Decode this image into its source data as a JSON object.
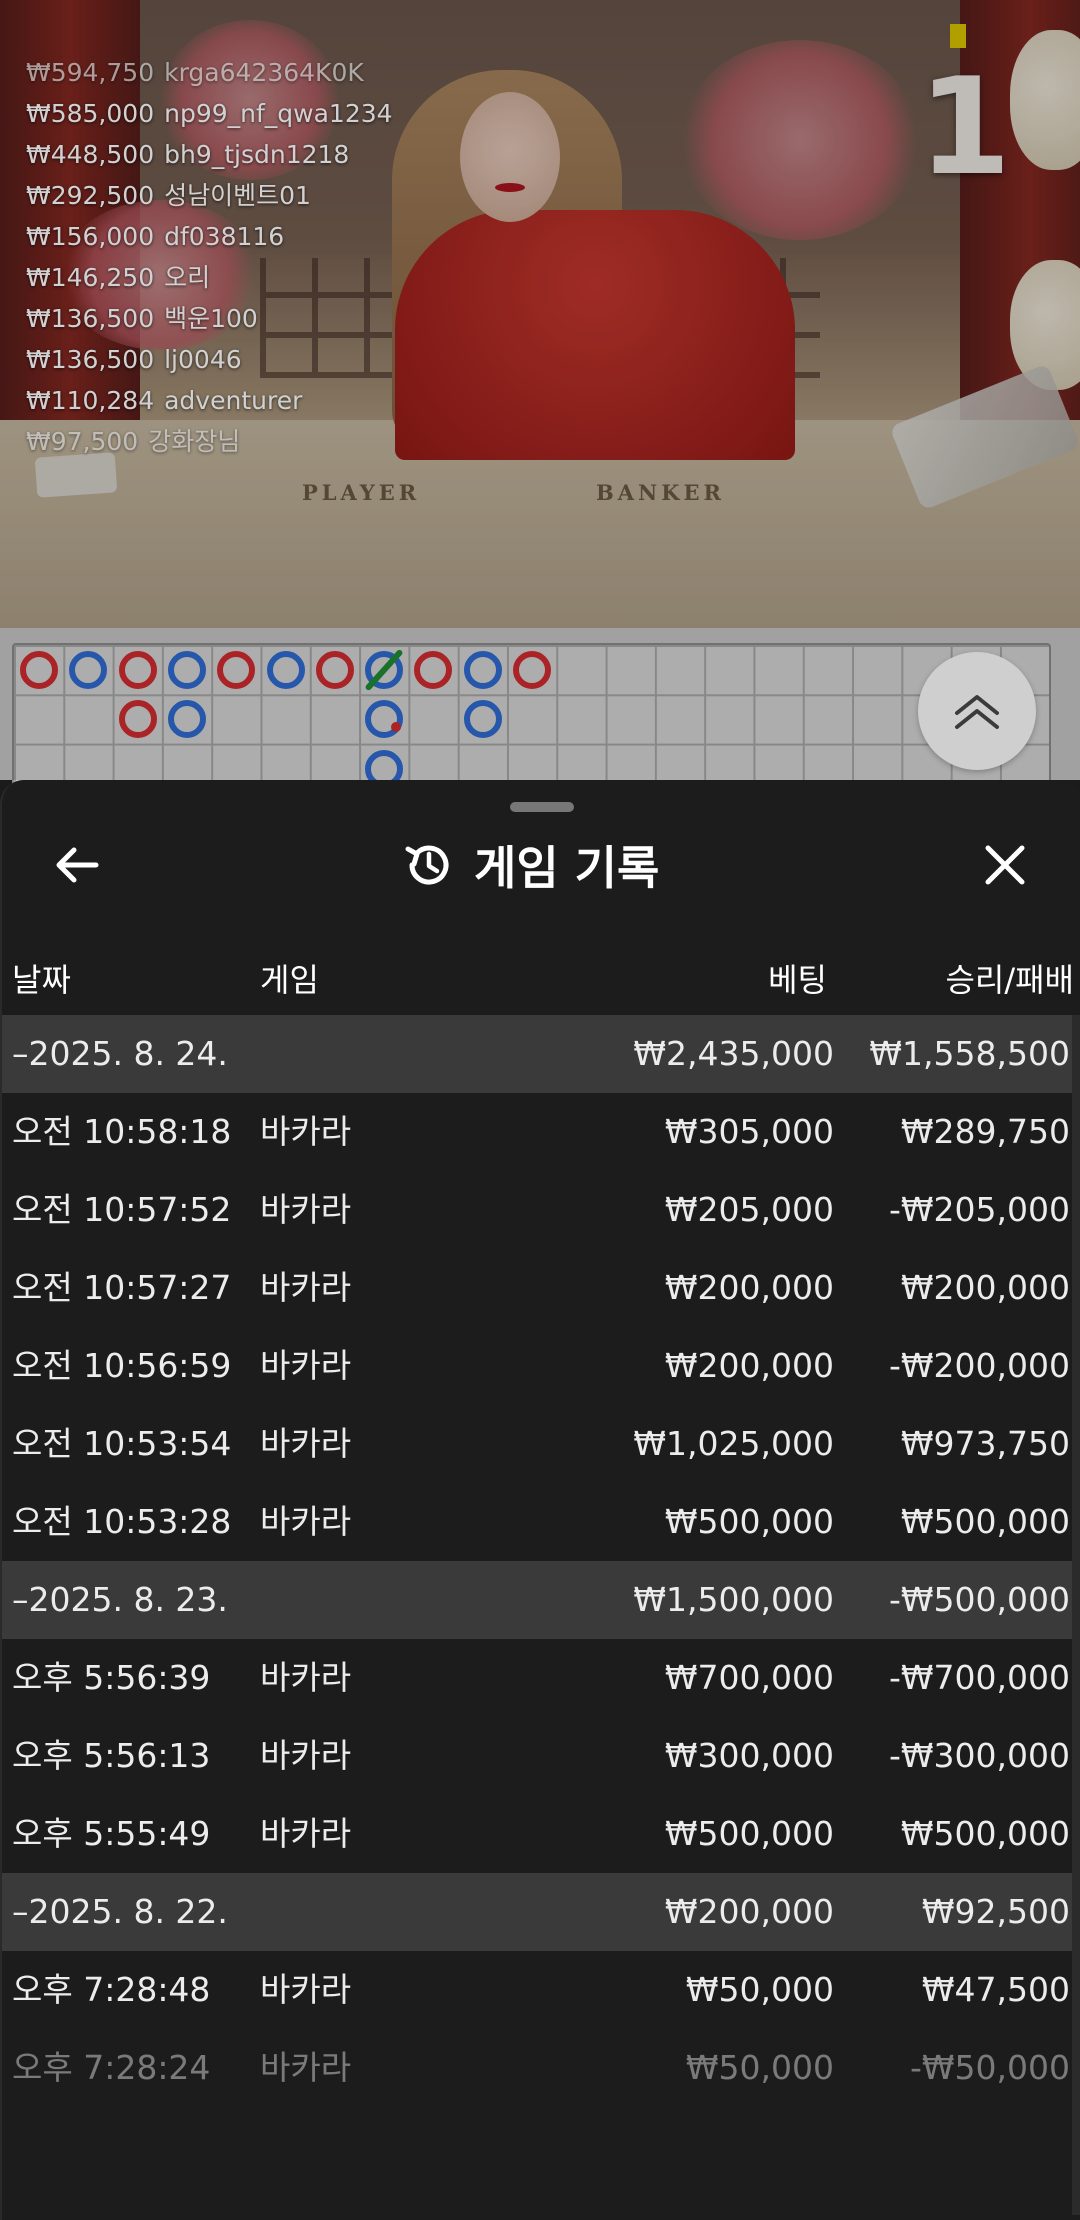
{
  "video": {
    "leaderboard": [
      {
        "amount": "₩594,750",
        "name": "krga642364K0K"
      },
      {
        "amount": "₩585,000",
        "name": "np99_nf_qwa1234"
      },
      {
        "amount": "₩448,500",
        "name": "bh9_tjsdn1218"
      },
      {
        "amount": "₩292,500",
        "name": "성남이벤트01"
      },
      {
        "amount": "₩156,000",
        "name": "df038116"
      },
      {
        "amount": "₩146,250",
        "name": "오리"
      },
      {
        "amount": "₩136,500",
        "name": "백운100"
      },
      {
        "amount": "₩136,500",
        "name": "lj0046"
      },
      {
        "amount": "₩110,284",
        "name": "adventurer"
      },
      {
        "amount": "₩97,500",
        "name": "강화장님"
      }
    ],
    "round_number": "1",
    "table_labels": {
      "player": "PLAYER",
      "banker": "BANKER"
    }
  },
  "roadmap": {
    "colors": {
      "player": "#2f6bd0",
      "banker": "#d02b2f",
      "tie": "#1f8a34"
    },
    "beads": [
      {
        "col": 0,
        "row": 0,
        "side": "B"
      },
      {
        "col": 1,
        "row": 0,
        "side": "P"
      },
      {
        "col": 2,
        "row": 0,
        "side": "B"
      },
      {
        "col": 2,
        "row": 1,
        "side": "B"
      },
      {
        "col": 3,
        "row": 0,
        "side": "P"
      },
      {
        "col": 3,
        "row": 1,
        "side": "P"
      },
      {
        "col": 4,
        "row": 0,
        "side": "B"
      },
      {
        "col": 5,
        "row": 0,
        "side": "P"
      },
      {
        "col": 6,
        "row": 0,
        "side": "B"
      },
      {
        "col": 7,
        "row": 0,
        "side": "P",
        "tie": true
      },
      {
        "col": 7,
        "row": 1,
        "side": "P",
        "banker_pair": true
      },
      {
        "col": 7,
        "row": 2,
        "side": "P"
      },
      {
        "col": 8,
        "row": 0,
        "side": "B"
      },
      {
        "col": 9,
        "row": 0,
        "side": "P"
      },
      {
        "col": 9,
        "row": 1,
        "side": "P"
      },
      {
        "col": 10,
        "row": 0,
        "side": "B"
      }
    ],
    "expand_icon": "double-chevron-up-icon"
  },
  "sheet": {
    "title": "게임 기록",
    "title_icon": "history-icon",
    "back_icon": "arrow-left-icon",
    "close_icon": "close-icon",
    "columns": {
      "date": "날짜",
      "game": "게임",
      "bet": "베팅",
      "result": "승리/패배"
    },
    "rows": [
      {
        "type": "date",
        "date": "–2025. 8. 24.",
        "game": "",
        "bet": "₩2,435,000",
        "result": "₩1,558,500"
      },
      {
        "type": "entry",
        "date": "오전 10:58:18",
        "game": "바카라",
        "bet": "₩305,000",
        "result": "₩289,750"
      },
      {
        "type": "entry",
        "date": "오전 10:57:52",
        "game": "바카라",
        "bet": "₩205,000",
        "result": "-₩205,000"
      },
      {
        "type": "entry",
        "date": "오전 10:57:27",
        "game": "바카라",
        "bet": "₩200,000",
        "result": "₩200,000"
      },
      {
        "type": "entry",
        "date": "오전 10:56:59",
        "game": "바카라",
        "bet": "₩200,000",
        "result": "-₩200,000"
      },
      {
        "type": "entry",
        "date": "오전 10:53:54",
        "game": "바카라",
        "bet": "₩1,025,000",
        "result": "₩973,750"
      },
      {
        "type": "entry",
        "date": "오전 10:53:28",
        "game": "바카라",
        "bet": "₩500,000",
        "result": "₩500,000"
      },
      {
        "type": "date",
        "date": "–2025. 8. 23.",
        "game": "",
        "bet": "₩1,500,000",
        "result": "-₩500,000"
      },
      {
        "type": "entry",
        "date": "오후 5:56:39",
        "game": "바카라",
        "bet": "₩700,000",
        "result": "-₩700,000"
      },
      {
        "type": "entry",
        "date": "오후 5:56:13",
        "game": "바카라",
        "bet": "₩300,000",
        "result": "-₩300,000"
      },
      {
        "type": "entry",
        "date": "오후 5:55:49",
        "game": "바카라",
        "bet": "₩500,000",
        "result": "₩500,000"
      },
      {
        "type": "date",
        "date": "–2025. 8. 22.",
        "game": "",
        "bet": "₩200,000",
        "result": "₩92,500"
      },
      {
        "type": "entry",
        "date": "오후 7:28:48",
        "game": "바카라",
        "bet": "₩50,000",
        "result": "₩47,500"
      },
      {
        "type": "entry",
        "date": "오후 7:28:24",
        "game": "바카라",
        "bet": "₩50,000",
        "result": "-₩50,000",
        "faded": true
      }
    ]
  }
}
